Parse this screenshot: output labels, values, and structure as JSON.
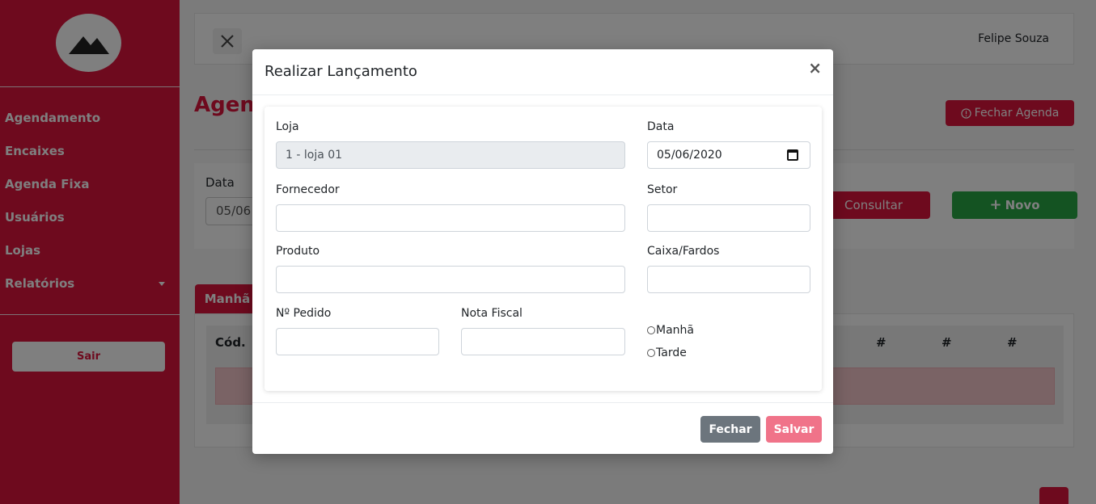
{
  "sidebar": {
    "logo_icon": "mountain-icon",
    "items": [
      {
        "label": "Agendamento"
      },
      {
        "label": "Encaixes"
      },
      {
        "label": "Agenda Fixa"
      },
      {
        "label": "Usuários"
      },
      {
        "label": "Lojas"
      },
      {
        "label": "Relatórios"
      }
    ],
    "logout_label": "Sair"
  },
  "topbar": {
    "user_name": "Felipe Souza"
  },
  "page": {
    "title": "Agend",
    "close_agenda_label": "Fechar Agenda",
    "filter_label": "Data",
    "filter_value": "05/06",
    "consult_label": "Consultar",
    "new_label": "Novo",
    "tab_label": "Manhã",
    "table_headers": [
      "Cód.",
      "#",
      "#",
      "#"
    ]
  },
  "modal": {
    "title": "Realizar Lançamento",
    "close_glyph": "×",
    "fields": {
      "loja_label": "Loja",
      "loja_value": "1 - loja 01",
      "data_label": "Data",
      "data_value": "05/06/2020",
      "fornecedor_label": "Fornecedor",
      "setor_label": "Setor",
      "produto_label": "Produto",
      "caixa_label": "Caixa/Fardos",
      "pedido_label": "Nº Pedido",
      "nota_label": "Nota Fiscal",
      "radio_manha": "Manhã",
      "radio_tarde": "Tarde"
    },
    "footer": {
      "close_label": "Fechar",
      "save_label": "Salvar"
    }
  },
  "colors": {
    "primary": "#dc143c",
    "success": "#28a745",
    "secondary": "#6c757d"
  }
}
